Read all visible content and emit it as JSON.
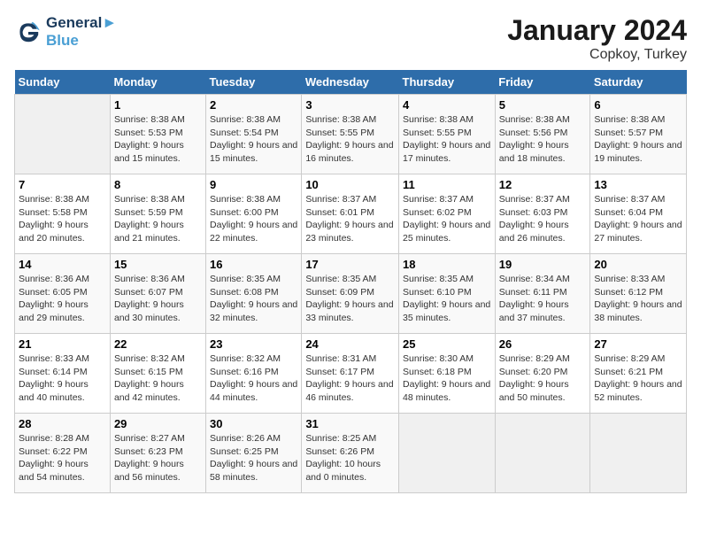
{
  "header": {
    "logo_line1": "General",
    "logo_line2": "Blue",
    "month": "January 2024",
    "location": "Copkoy, Turkey"
  },
  "days_of_week": [
    "Sunday",
    "Monday",
    "Tuesday",
    "Wednesday",
    "Thursday",
    "Friday",
    "Saturday"
  ],
  "weeks": [
    [
      {
        "day": "",
        "empty": true
      },
      {
        "day": "1",
        "sunrise": "8:38 AM",
        "sunset": "5:53 PM",
        "daylight": "9 hours and 15 minutes."
      },
      {
        "day": "2",
        "sunrise": "8:38 AM",
        "sunset": "5:54 PM",
        "daylight": "9 hours and 15 minutes."
      },
      {
        "day": "3",
        "sunrise": "8:38 AM",
        "sunset": "5:55 PM",
        "daylight": "9 hours and 16 minutes."
      },
      {
        "day": "4",
        "sunrise": "8:38 AM",
        "sunset": "5:55 PM",
        "daylight": "9 hours and 17 minutes."
      },
      {
        "day": "5",
        "sunrise": "8:38 AM",
        "sunset": "5:56 PM",
        "daylight": "9 hours and 18 minutes."
      },
      {
        "day": "6",
        "sunrise": "8:38 AM",
        "sunset": "5:57 PM",
        "daylight": "9 hours and 19 minutes."
      }
    ],
    [
      {
        "day": "7",
        "sunrise": "8:38 AM",
        "sunset": "5:58 PM",
        "daylight": "9 hours and 20 minutes."
      },
      {
        "day": "8",
        "sunrise": "8:38 AM",
        "sunset": "5:59 PM",
        "daylight": "9 hours and 21 minutes."
      },
      {
        "day": "9",
        "sunrise": "8:38 AM",
        "sunset": "6:00 PM",
        "daylight": "9 hours and 22 minutes."
      },
      {
        "day": "10",
        "sunrise": "8:37 AM",
        "sunset": "6:01 PM",
        "daylight": "9 hours and 23 minutes."
      },
      {
        "day": "11",
        "sunrise": "8:37 AM",
        "sunset": "6:02 PM",
        "daylight": "9 hours and 25 minutes."
      },
      {
        "day": "12",
        "sunrise": "8:37 AM",
        "sunset": "6:03 PM",
        "daylight": "9 hours and 26 minutes."
      },
      {
        "day": "13",
        "sunrise": "8:37 AM",
        "sunset": "6:04 PM",
        "daylight": "9 hours and 27 minutes."
      }
    ],
    [
      {
        "day": "14",
        "sunrise": "8:36 AM",
        "sunset": "6:05 PM",
        "daylight": "9 hours and 29 minutes."
      },
      {
        "day": "15",
        "sunrise": "8:36 AM",
        "sunset": "6:07 PM",
        "daylight": "9 hours and 30 minutes."
      },
      {
        "day": "16",
        "sunrise": "8:35 AM",
        "sunset": "6:08 PM",
        "daylight": "9 hours and 32 minutes."
      },
      {
        "day": "17",
        "sunrise": "8:35 AM",
        "sunset": "6:09 PM",
        "daylight": "9 hours and 33 minutes."
      },
      {
        "day": "18",
        "sunrise": "8:35 AM",
        "sunset": "6:10 PM",
        "daylight": "9 hours and 35 minutes."
      },
      {
        "day": "19",
        "sunrise": "8:34 AM",
        "sunset": "6:11 PM",
        "daylight": "9 hours and 37 minutes."
      },
      {
        "day": "20",
        "sunrise": "8:33 AM",
        "sunset": "6:12 PM",
        "daylight": "9 hours and 38 minutes."
      }
    ],
    [
      {
        "day": "21",
        "sunrise": "8:33 AM",
        "sunset": "6:14 PM",
        "daylight": "9 hours and 40 minutes."
      },
      {
        "day": "22",
        "sunrise": "8:32 AM",
        "sunset": "6:15 PM",
        "daylight": "9 hours and 42 minutes."
      },
      {
        "day": "23",
        "sunrise": "8:32 AM",
        "sunset": "6:16 PM",
        "daylight": "9 hours and 44 minutes."
      },
      {
        "day": "24",
        "sunrise": "8:31 AM",
        "sunset": "6:17 PM",
        "daylight": "9 hours and 46 minutes."
      },
      {
        "day": "25",
        "sunrise": "8:30 AM",
        "sunset": "6:18 PM",
        "daylight": "9 hours and 48 minutes."
      },
      {
        "day": "26",
        "sunrise": "8:29 AM",
        "sunset": "6:20 PM",
        "daylight": "9 hours and 50 minutes."
      },
      {
        "day": "27",
        "sunrise": "8:29 AM",
        "sunset": "6:21 PM",
        "daylight": "9 hours and 52 minutes."
      }
    ],
    [
      {
        "day": "28",
        "sunrise": "8:28 AM",
        "sunset": "6:22 PM",
        "daylight": "9 hours and 54 minutes."
      },
      {
        "day": "29",
        "sunrise": "8:27 AM",
        "sunset": "6:23 PM",
        "daylight": "9 hours and 56 minutes."
      },
      {
        "day": "30",
        "sunrise": "8:26 AM",
        "sunset": "6:25 PM",
        "daylight": "9 hours and 58 minutes."
      },
      {
        "day": "31",
        "sunrise": "8:25 AM",
        "sunset": "6:26 PM",
        "daylight": "10 hours and 0 minutes."
      },
      {
        "day": "",
        "empty": true
      },
      {
        "day": "",
        "empty": true
      },
      {
        "day": "",
        "empty": true
      }
    ]
  ]
}
